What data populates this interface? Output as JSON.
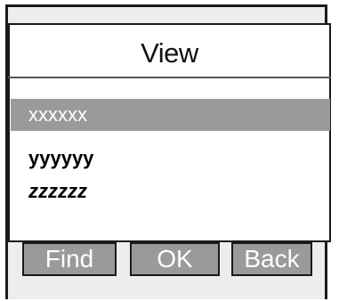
{
  "window": {
    "title": "View"
  },
  "list": {
    "items": [
      {
        "label": "xxxxxx",
        "selected": true
      },
      {
        "label": "yyyyyy",
        "selected": false
      },
      {
        "label": "zzzzzz",
        "selected": false
      }
    ]
  },
  "softkeys": {
    "left": "Find",
    "center": "OK",
    "right": "Back"
  },
  "colors": {
    "selection": "#9a9a9a",
    "border": "#1a1a1a",
    "background": "#ffffff"
  }
}
